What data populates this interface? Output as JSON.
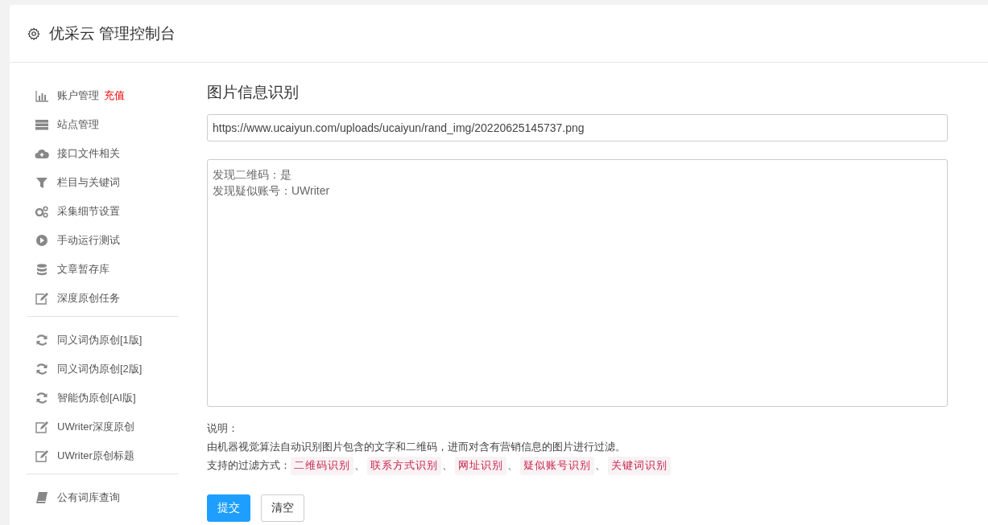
{
  "header": {
    "title": "优采云 管理控制台"
  },
  "sidebar": {
    "groups": [
      {
        "items": [
          {
            "label": "账户管理",
            "kind": "chart",
            "badge": "充值"
          },
          {
            "label": "站点管理",
            "kind": "server"
          },
          {
            "label": "接口文件相关",
            "kind": "cloud"
          },
          {
            "label": "栏目与关键词",
            "kind": "filter"
          },
          {
            "label": "采集细节设置",
            "kind": "gears"
          },
          {
            "label": "手动运行测试",
            "kind": "play"
          },
          {
            "label": "文章暂存库",
            "kind": "database"
          },
          {
            "label": "深度原创任务",
            "kind": "edit"
          }
        ]
      },
      {
        "items": [
          {
            "label": "同义词伪原创[1版]",
            "kind": "refresh"
          },
          {
            "label": "同义词伪原创[2版]",
            "kind": "refresh"
          },
          {
            "label": "智能伪原创[AI版]",
            "kind": "refresh"
          },
          {
            "label": "UWriter深度原创",
            "kind": "edit"
          },
          {
            "label": "UWriter原创标题",
            "kind": "edit"
          }
        ]
      },
      {
        "items": [
          {
            "label": "公有词库查询",
            "kind": "book"
          }
        ]
      }
    ]
  },
  "main": {
    "title": "图片信息识别",
    "url_field": {
      "value": "https://www.ucaiyun.com/uploads/ucaiyun/rand_img/20220625145737.png"
    },
    "result": {
      "lines": [
        "发现二维码：是",
        "发现疑似账号：UWriter"
      ]
    },
    "notes": {
      "heading": "说明：",
      "description": "由机器视觉算法自动识别图片包含的文字和二维码，进而对含有营销信息的图片进行过滤。",
      "methods_label": "支持的过滤方式：",
      "methods": [
        {
          "label": "二维码识别",
          "separator": "、"
        },
        {
          "label": "联系方式识别",
          "separator": "、"
        },
        {
          "label": "网址识别",
          "separator": "、"
        },
        {
          "label": "疑似账号识别",
          "separator": "、"
        },
        {
          "label": "关键词识别"
        }
      ]
    },
    "buttons": [
      {
        "label": "提交",
        "kind": "primary"
      },
      {
        "label": "清空",
        "kind": "default"
      }
    ]
  }
}
